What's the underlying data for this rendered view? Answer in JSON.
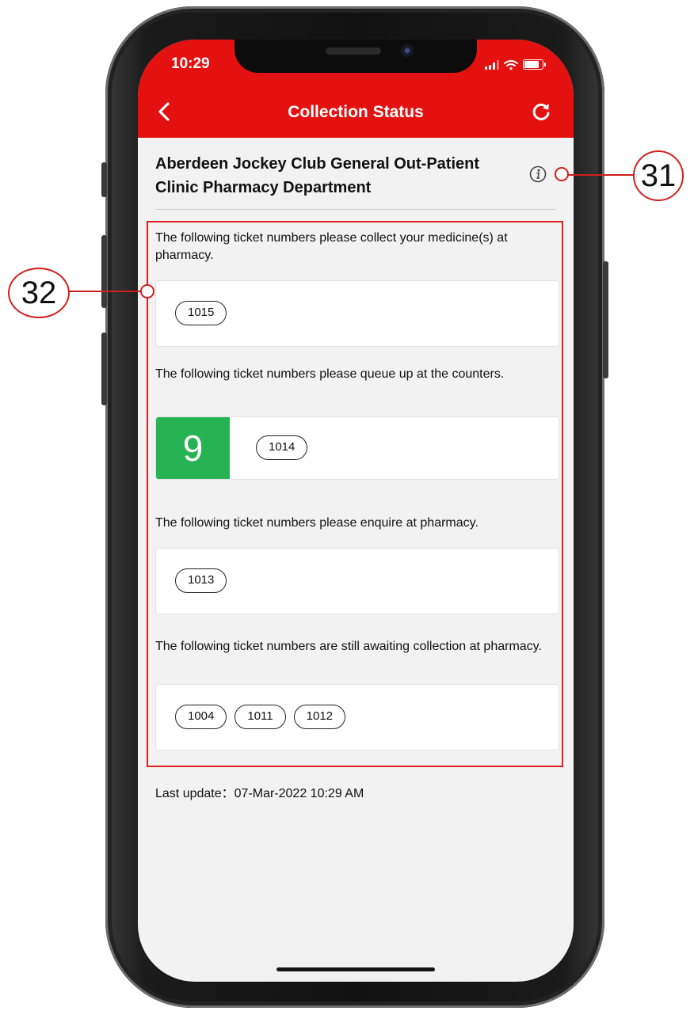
{
  "status_bar": {
    "time": "10:29"
  },
  "header": {
    "title": "Collection Status"
  },
  "clinic": {
    "name": "Aberdeen Jockey Club General Out-Patient Clinic Pharmacy Department"
  },
  "sections": [
    {
      "text": "The following ticket numbers please collect your medicine(s) at pharmacy.",
      "tickets": [
        "1015"
      ]
    },
    {
      "text": "The following ticket numbers please queue up at the counters.",
      "counter": "9",
      "tickets": [
        "1014"
      ]
    },
    {
      "text": "The following ticket numbers please enquire at pharmacy.",
      "tickets": [
        "1013"
      ]
    },
    {
      "text": "The following ticket numbers are still awaiting collection at pharmacy.",
      "tickets": [
        "1004",
        "1011",
        "1012"
      ]
    }
  ],
  "last_update": "Last update：07-Mar-2022 10:29 AM",
  "annotations": {
    "callout_1": "31",
    "callout_2": "32"
  },
  "colors": {
    "header": "#e3110f",
    "counter": "#27b354",
    "annotation": "#d21f1f"
  },
  "icons": [
    "back-icon",
    "refresh-icon",
    "info-icon",
    "signal-icon",
    "wifi-icon",
    "battery-icon"
  ]
}
